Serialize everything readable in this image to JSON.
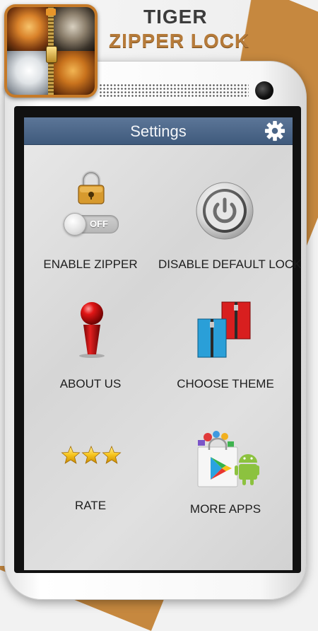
{
  "promo": {
    "title_line1": "TIGER",
    "title_line2": "ZIPPER LOCK"
  },
  "settings": {
    "header_title": "Settings",
    "items": [
      {
        "label": "ENABLE ZIPPER",
        "icon": "padlock-icon",
        "toggle_state": "OFF"
      },
      {
        "label": "DISABLE DEFAULT LOCK",
        "icon": "power-button-icon"
      },
      {
        "label": "ABOUT US",
        "icon": "info-pin-icon"
      },
      {
        "label": "CHOOSE THEME",
        "icon": "zipper-cards-icon"
      },
      {
        "label": "RATE",
        "icon": "stars-icon"
      },
      {
        "label": "MORE APPS",
        "icon": "play-store-bag-icon"
      }
    ]
  },
  "colors": {
    "header_bar": "#4b6688",
    "accent_orange": "#c6883f",
    "title_dark": "#3c3c3c",
    "title_gold": "#b67b3a"
  }
}
